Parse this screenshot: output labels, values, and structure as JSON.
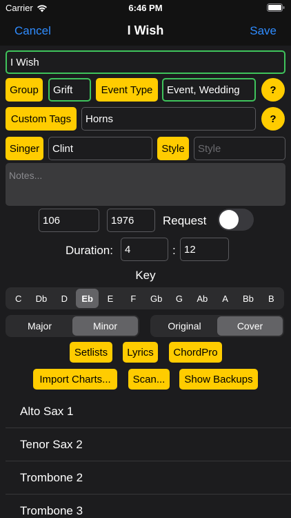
{
  "status": {
    "carrier": "Carrier",
    "time": "6:46 PM"
  },
  "nav": {
    "cancel": "Cancel",
    "title": "I Wish",
    "save": "Save"
  },
  "form": {
    "title_value": "I Wish",
    "group_label": "Group",
    "group_value": "Grift",
    "event_type_label": "Event Type",
    "event_type_value": "Event, Wedding",
    "help_label": "?",
    "custom_tags_label": "Custom Tags",
    "custom_tags_value": "Horns",
    "singer_label": "Singer",
    "singer_value": "Clint",
    "style_label": "Style",
    "style_placeholder": "Style",
    "notes_placeholder": "Notes...",
    "bpm_value": "106",
    "year_value": "1976",
    "request_label": "Request",
    "request_on": false,
    "duration_label": "Duration:",
    "duration_min": "4",
    "duration_sep": ":",
    "duration_sec": "12",
    "key_label": "Key"
  },
  "keys": [
    "C",
    "Db",
    "D",
    "Eb",
    "E",
    "F",
    "Gb",
    "G",
    "Ab",
    "A",
    "Bb",
    "B"
  ],
  "selected_key": "Eb",
  "mode": {
    "options": [
      "Major",
      "Minor"
    ],
    "selected": "Minor"
  },
  "version": {
    "options": [
      "Original",
      "Cover"
    ],
    "selected": "Cover"
  },
  "buttons": {
    "setlists": "Setlists",
    "lyrics": "Lyrics",
    "chordpro": "ChordPro",
    "import_charts": "Import Charts...",
    "scan": "Scan...",
    "show_backups": "Show Backups"
  },
  "charts": [
    "Alto Sax 1",
    "Tenor Sax 2",
    "Trombone 2",
    "Trombone 3"
  ],
  "colors": {
    "accent": "#ffcc00",
    "link": "#2f8cff",
    "focus": "#3fc45c",
    "background": "#1c1c1e"
  }
}
